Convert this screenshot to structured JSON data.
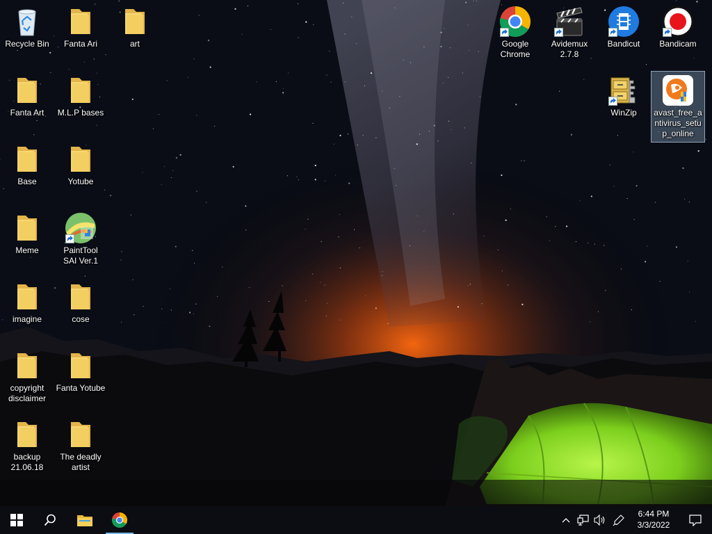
{
  "desktop": {
    "left_icons": [
      {
        "label": "Recycle Bin",
        "icon": "recycle-bin-icon"
      },
      {
        "label": "Fanta Ari",
        "icon": "folder-icon"
      },
      {
        "label": "art",
        "icon": "folder-icon"
      },
      {
        "label": "Fanta Art",
        "icon": "folder-icon"
      },
      {
        "label": "M.L.P bases",
        "icon": "folder-icon"
      },
      {
        "label": "Base",
        "icon": "folder-icon"
      },
      {
        "label": "Yotube",
        "icon": "folder-icon"
      },
      {
        "label": "Meme",
        "icon": "folder-icon"
      },
      {
        "label": "PaintTool SAI Ver.1",
        "icon": "painttool-sai-icon"
      },
      {
        "label": "imagine",
        "icon": "folder-icon"
      },
      {
        "label": "cose",
        "icon": "folder-icon"
      },
      {
        "label": "copyright disclaimer",
        "icon": "folder-icon"
      },
      {
        "label": "Fanta Yotube",
        "icon": "folder-icon"
      },
      {
        "label": "backup 21.06.18",
        "icon": "folder-icon"
      },
      {
        "label": "The deadly artist",
        "icon": "folder-icon"
      }
    ],
    "right_icons": [
      {
        "label": "Google Chrome",
        "icon": "chrome-icon"
      },
      {
        "label": "Avidemux 2.7.8",
        "icon": "avidemux-clapperboard-icon"
      },
      {
        "label": "Bandicut",
        "icon": "bandicut-film-icon"
      },
      {
        "label": "Bandicam",
        "icon": "bandicam-record-icon"
      },
      {
        "label": "WinZip",
        "icon": "winzip-cabinet-icon"
      },
      {
        "label": "avast_free_antivirus_setup_online",
        "icon": "avast-installer-icon"
      }
    ]
  },
  "taskbar": {
    "start": "windows-start-icon",
    "search": "search-icon",
    "pinned": [
      {
        "name": "File Explorer",
        "icon": "file-explorer-icon"
      },
      {
        "name": "Google Chrome",
        "icon": "chrome-icon",
        "active": true
      }
    ],
    "tray_icons": [
      "chevron-up-icon",
      "network-icon",
      "volume-icon",
      "pen-ink-icon"
    ],
    "clock": {
      "time": "6:44 PM",
      "date": "3/3/2022"
    },
    "notifications": "action-center-icon"
  },
  "colors": {
    "folder": "#f3cf62",
    "taskbar": "#0b0d12",
    "accent": "#76b9ed",
    "tent": "#8fe02a"
  }
}
